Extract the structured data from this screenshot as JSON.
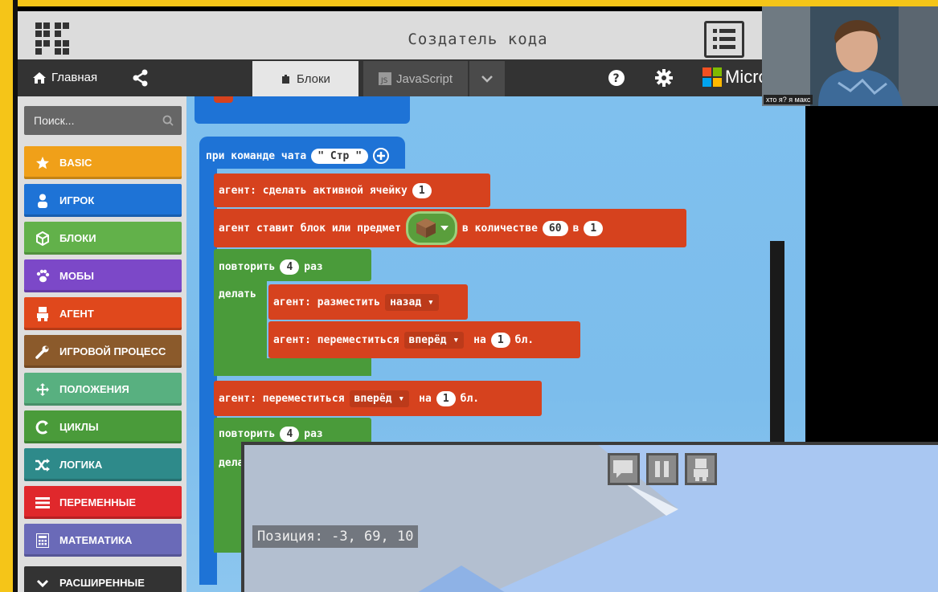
{
  "window": {
    "title": "Создатель кода"
  },
  "nav": {
    "home_label": "Главная",
    "blocks_tab": "Блоки",
    "js_tab": "JavaScript",
    "brand": "Micrс"
  },
  "toolbox": {
    "search_placeholder": "Поиск...",
    "categories": [
      {
        "label": "BASIC",
        "color": "#f0a019",
        "icon": "star-icon"
      },
      {
        "label": "ИГРОК",
        "color": "#1e73d6",
        "icon": "player-icon"
      },
      {
        "label": "БЛОКИ",
        "color": "#62b14a",
        "icon": "cube-icon"
      },
      {
        "label": "МОБЫ",
        "color": "#7c48c8",
        "icon": "paw-icon"
      },
      {
        "label": "АГЕНТ",
        "color": "#e0481c",
        "icon": "agent-icon"
      },
      {
        "label": "ИГРОВОЙ ПРОЦЕСС",
        "color": "#8b5a2b",
        "icon": "wrench-icon"
      },
      {
        "label": "ПОЛОЖЕНИЯ",
        "color": "#58b080",
        "icon": "move-icon"
      },
      {
        "label": "ЦИКЛЫ",
        "color": "#4a9b3a",
        "icon": "loop-icon"
      },
      {
        "label": "ЛОГИКА",
        "color": "#2e8a8a",
        "icon": "shuffle-icon"
      },
      {
        "label": "ПЕРЕМЕННЫЕ",
        "color": "#e0282c",
        "icon": "list-icon"
      },
      {
        "label": "МАТЕМАТИКА",
        "color": "#6a6ab8",
        "icon": "calculator-icon"
      },
      {
        "label": "РАСШИРЕННЫЕ",
        "color": "#333333",
        "icon": "chevron-down-icon"
      }
    ]
  },
  "code": {
    "on_chat": "при команде чата",
    "chat_cmd": "\" Стр \"",
    "set_slot": "агент: сделать активной ячейку",
    "slot_val": "1",
    "place_block": "агент ставит блок или предмет",
    "amount_text": "в количестве",
    "amount_val": "60",
    "in_text": "в",
    "in_val": "1",
    "repeat1": "повторить",
    "repeat1_val": "4",
    "times": "раз",
    "do_text": "делать",
    "place_dir": "агент: разместить",
    "place_dir_val": "назад",
    "move1": "агент: переместиться",
    "move1_dir": "вперёд",
    "on_text": "на",
    "move1_val": "1",
    "bl": "бл.",
    "move2": "агент: переместиться",
    "move2_dir": "вперёд",
    "move2_val": "1",
    "repeat2": "повторить",
    "repeat2_val": "4",
    "do_text2": "дела"
  },
  "webcam": {
    "label": "хто я? я макс"
  },
  "minecraft": {
    "position": "Позиция: -3, 69, 10"
  }
}
